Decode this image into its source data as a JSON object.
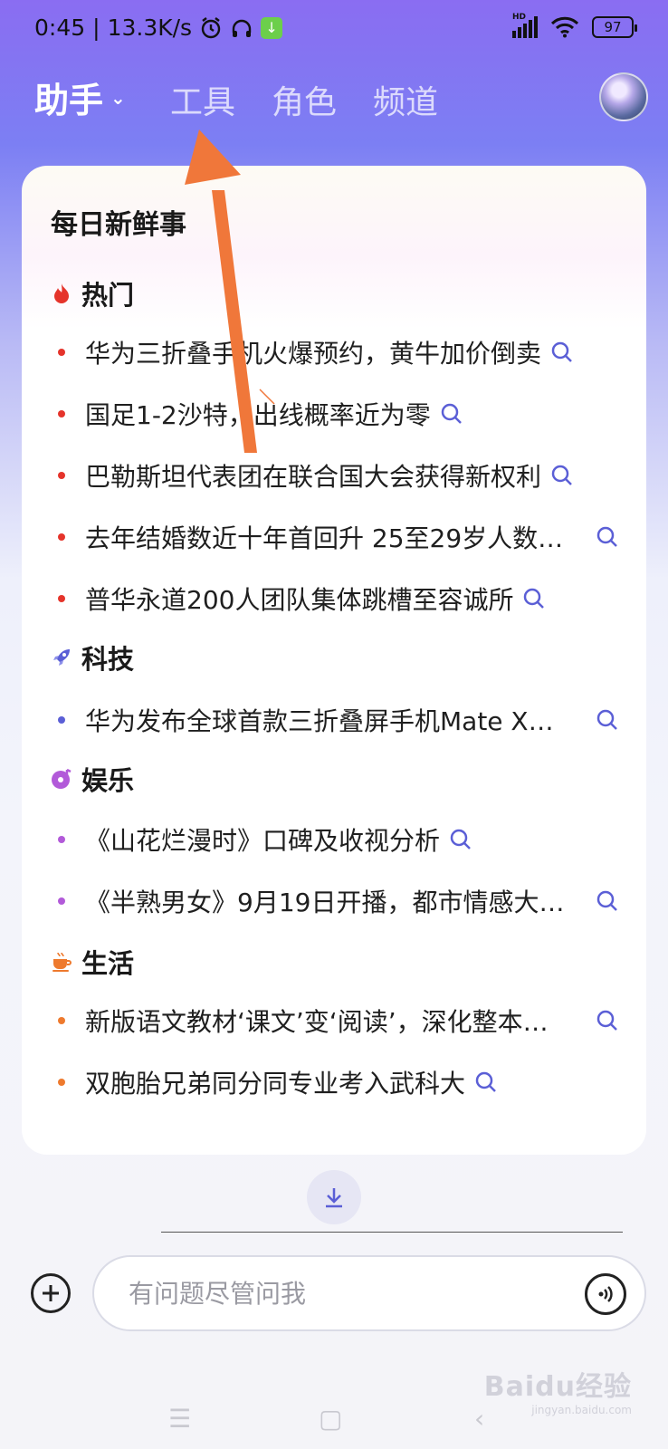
{
  "status": {
    "time": "0:45",
    "speed": "13.3K/s",
    "network": "HD",
    "battery": "97"
  },
  "nav": {
    "main": "助手",
    "tabs": [
      "工具",
      "角色",
      "频道"
    ]
  },
  "card": {
    "title": "每日新鲜事",
    "sections": [
      {
        "name": "热门",
        "color": "#e5342b",
        "items": [
          "华为三折叠手机火爆预约，黄牛加价倒卖",
          "国足1-2沙特，出线概率近为零",
          "巴勒斯坦代表团在联合国大会获得新权利",
          "去年结婚数近十年首回升 25至29岁人数…",
          "普华永道200人团队集体跳槽至容诚所"
        ]
      },
      {
        "name": "科技",
        "color": "#5b5fd6",
        "items": [
          "华为发布全球首款三折叠屏手机Mate X…"
        ]
      },
      {
        "name": "娱乐",
        "color": "#b25ad9",
        "items": [
          "《山花烂漫时》口碑及收视分析",
          "《半熟男女》9月19日开播，都市情感大…"
        ]
      },
      {
        "name": "生活",
        "color": "#ee7a2e",
        "items": [
          "新版语文教材‘课文’变‘阅读’，深化整本…",
          "双胞胎兄弟同分同专业考入武科大"
        ]
      }
    ]
  },
  "input": {
    "placeholder": "有问题尽管问我"
  },
  "watermark": {
    "text": "Baidu经验",
    "sub": "jingyan.baidu.com"
  },
  "colors": {
    "accent": "#5b5fd6",
    "annotation_arrow": "#f0773a"
  },
  "icons": [
    "fire-icon",
    "rocket-icon",
    "music-disc-icon",
    "coffee-cup-icon",
    "search-icon",
    "download-arrow-icon",
    "plus-icon",
    "voice-icon",
    "avatar"
  ]
}
